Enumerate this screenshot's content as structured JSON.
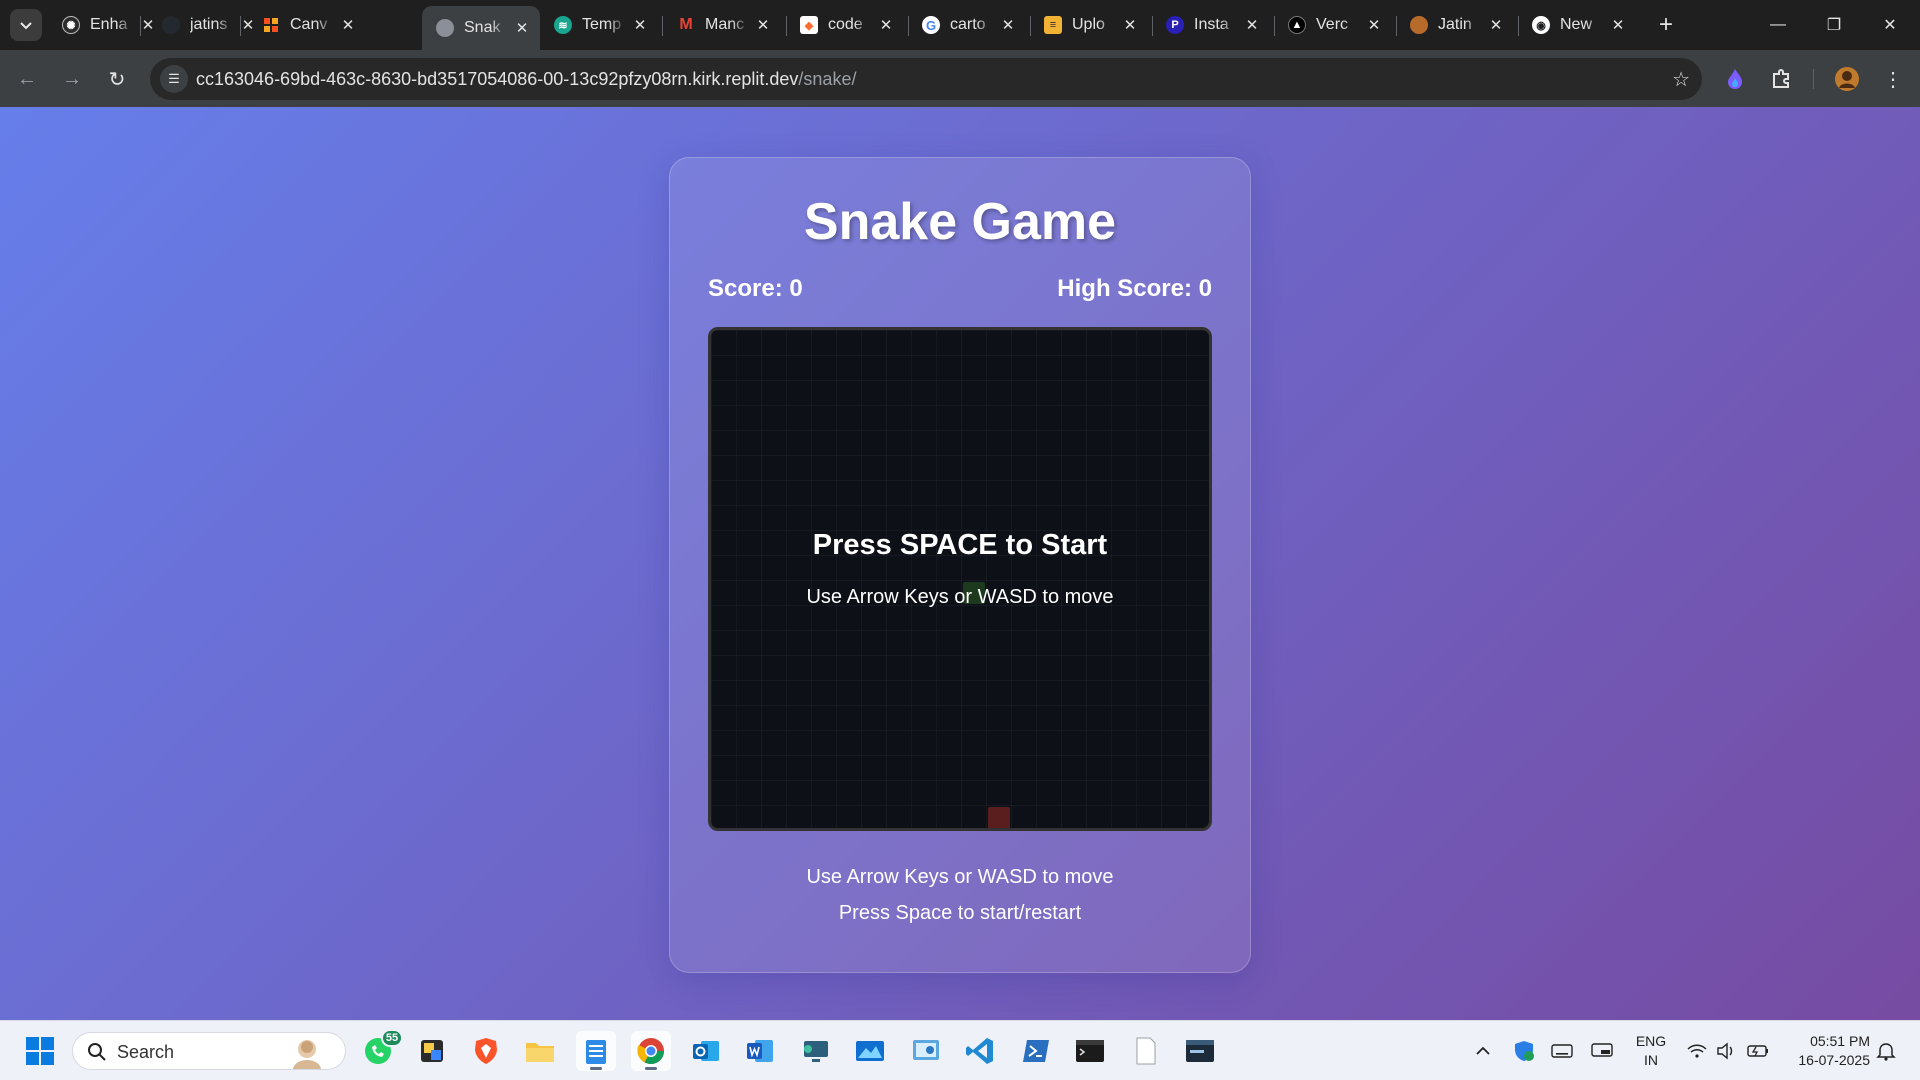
{
  "browser": {
    "tabs": [
      {
        "title": "Enha",
        "icon": "openai-icon",
        "color": "#ffffff"
      },
      {
        "title": "jatins",
        "icon": "github-icon",
        "color": "#24292f"
      },
      {
        "title": "Canv",
        "icon": "canva-icon",
        "color": "#f4511e"
      },
      {
        "title": "Snak",
        "icon": "globe-icon",
        "color": "#8a8f98"
      },
      {
        "title": "Temp",
        "icon": "temp-icon",
        "color": "#1aa58f"
      },
      {
        "title": "Manc",
        "icon": "gmail-icon",
        "color": "#ea4335"
      },
      {
        "title": "code",
        "icon": "code-icon",
        "color": "#ff6b2c"
      },
      {
        "title": "carto",
        "icon": "google-icon",
        "color": "#4285f4"
      },
      {
        "title": "Uplo",
        "icon": "upload-icon",
        "color": "#f2b233"
      },
      {
        "title": "Insta",
        "icon": "p-icon",
        "color": "#3b2bd8"
      },
      {
        "title": "Verc",
        "icon": "vercel-icon",
        "color": "#000000"
      },
      {
        "title": "Jatin",
        "icon": "profile-icon",
        "color": "#b76b2a"
      },
      {
        "title": "New",
        "icon": "chrome-icon",
        "color": "#ffffff"
      }
    ],
    "active_tab_index": 3,
    "url_host": "cc163046-69bd-463c-8630-bd3517054086-00-13c92pfzy08rn.kirk.replit.dev",
    "url_path": "/snake/"
  },
  "game": {
    "title": "Snake Game",
    "score_label": "Score: 0",
    "high_score_label": "High Score: 0",
    "overlay_title": "Press SPACE to Start",
    "overlay_subtitle": "Use Arrow Keys or WASD to move",
    "instructions": [
      "Use Arrow Keys or WASD to move",
      "Press Space to start/restart"
    ],
    "colors": {
      "background_start": "#667eea",
      "background_end": "#764ba2",
      "board": "#0d1117"
    }
  },
  "taskbar": {
    "search_placeholder": "Search",
    "whatsapp_badge": "55",
    "lang_line1": "ENG",
    "lang_line2": "IN",
    "time": "05:51 PM",
    "date": "16-07-2025"
  }
}
